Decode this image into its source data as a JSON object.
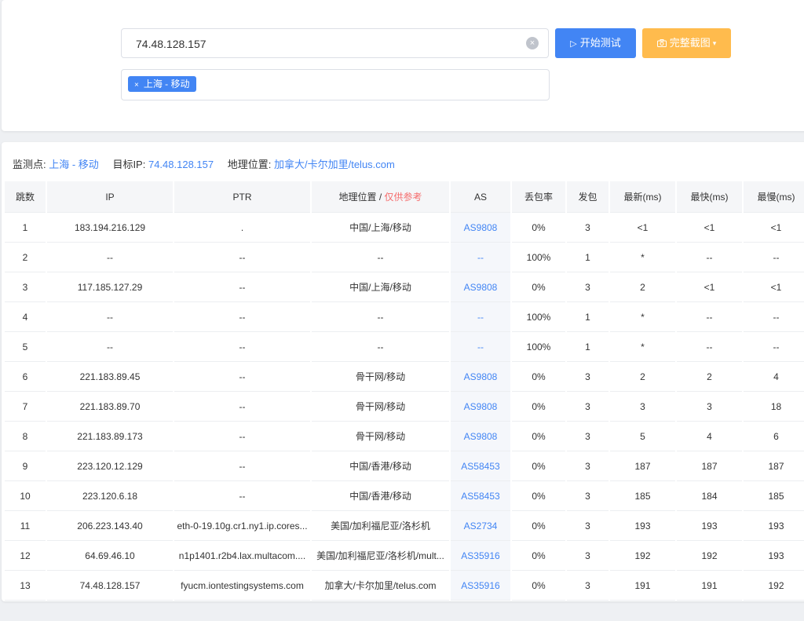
{
  "search": {
    "value": "74.48.128.157",
    "clear_icon": "×"
  },
  "buttons": {
    "start": "开始测试",
    "start_icon": "▷",
    "screenshot": "完整截图",
    "screenshot_icon": "camera-icon",
    "caret": "▾"
  },
  "tags": [
    {
      "label": "上海 - 移动",
      "remove": "×"
    }
  ],
  "info": {
    "monitor_label": "监测点:",
    "monitor_value": "上海 - 移动",
    "target_label": "目标IP:",
    "target_value": "74.48.128.157",
    "geo_label": "地理位置:",
    "geo_value": "加拿大/卡尔加里/telus.com"
  },
  "table": {
    "headers": {
      "hop": "跳数",
      "ip": "IP",
      "ptr": "PTR",
      "geo": "地理位置 / ",
      "geo_ref": "仅供参考",
      "as": "AS",
      "loss": "丢包率",
      "sent": "发包",
      "last": "最新(ms)",
      "best": "最快(ms)",
      "worst": "最慢(ms)"
    },
    "rows": [
      {
        "hop": "1",
        "ip": "183.194.216.129",
        "ptr": ".",
        "geo": "中国/上海/移动",
        "as": "AS9808",
        "loss": "0%",
        "sent": "3",
        "last": "<1",
        "best": "<1",
        "worst": "<1"
      },
      {
        "hop": "2",
        "ip": "--",
        "ptr": "--",
        "geo": "--",
        "as": "--",
        "loss": "100%",
        "sent": "1",
        "last": "*",
        "best": "--",
        "worst": "--"
      },
      {
        "hop": "3",
        "ip": "117.185.127.29",
        "ptr": "--",
        "geo": "中国/上海/移动",
        "as": "AS9808",
        "loss": "0%",
        "sent": "3",
        "last": "2",
        "best": "<1",
        "worst": "<1"
      },
      {
        "hop": "4",
        "ip": "--",
        "ptr": "--",
        "geo": "--",
        "as": "--",
        "loss": "100%",
        "sent": "1",
        "last": "*",
        "best": "--",
        "worst": "--"
      },
      {
        "hop": "5",
        "ip": "--",
        "ptr": "--",
        "geo": "--",
        "as": "--",
        "loss": "100%",
        "sent": "1",
        "last": "*",
        "best": "--",
        "worst": "--"
      },
      {
        "hop": "6",
        "ip": "221.183.89.45",
        "ptr": "--",
        "geo": "骨干网/移动",
        "as": "AS9808",
        "loss": "0%",
        "sent": "3",
        "last": "2",
        "best": "2",
        "worst": "4"
      },
      {
        "hop": "7",
        "ip": "221.183.89.70",
        "ptr": "--",
        "geo": "骨干网/移动",
        "as": "AS9808",
        "loss": "0%",
        "sent": "3",
        "last": "3",
        "best": "3",
        "worst": "18"
      },
      {
        "hop": "8",
        "ip": "221.183.89.173",
        "ptr": "--",
        "geo": "骨干网/移动",
        "as": "AS9808",
        "loss": "0%",
        "sent": "3",
        "last": "5",
        "best": "4",
        "worst": "6"
      },
      {
        "hop": "9",
        "ip": "223.120.12.129",
        "ptr": "--",
        "geo": "中国/香港/移动",
        "as": "AS58453",
        "loss": "0%",
        "sent": "3",
        "last": "187",
        "best": "187",
        "worst": "187"
      },
      {
        "hop": "10",
        "ip": "223.120.6.18",
        "ptr": "--",
        "geo": "中国/香港/移动",
        "as": "AS58453",
        "loss": "0%",
        "sent": "3",
        "last": "185",
        "best": "184",
        "worst": "185"
      },
      {
        "hop": "11",
        "ip": "206.223.143.40",
        "ptr": "eth-0-19.10g.cr1.ny1.ip.cores...",
        "geo": "美国/加利福尼亚/洛杉机",
        "as": "AS2734",
        "loss": "0%",
        "sent": "3",
        "last": "193",
        "best": "193",
        "worst": "193"
      },
      {
        "hop": "12",
        "ip": "64.69.46.10",
        "ptr": "n1p1401.r2b4.lax.multacom....",
        "geo": "美国/加利福尼亚/洛杉机/mult...",
        "as": "AS35916",
        "loss": "0%",
        "sent": "3",
        "last": "192",
        "best": "192",
        "worst": "193"
      },
      {
        "hop": "13",
        "ip": "74.48.128.157",
        "ptr": "fyucm.iontestingsystems.com",
        "geo": "加拿大/卡尔加里/telus.com",
        "as": "AS35916",
        "loss": "0%",
        "sent": "3",
        "last": "191",
        "best": "191",
        "worst": "192"
      }
    ]
  },
  "colors": {
    "primary": "#4285f4",
    "warning": "#ffbb4d",
    "danger": "#f56c6c"
  }
}
